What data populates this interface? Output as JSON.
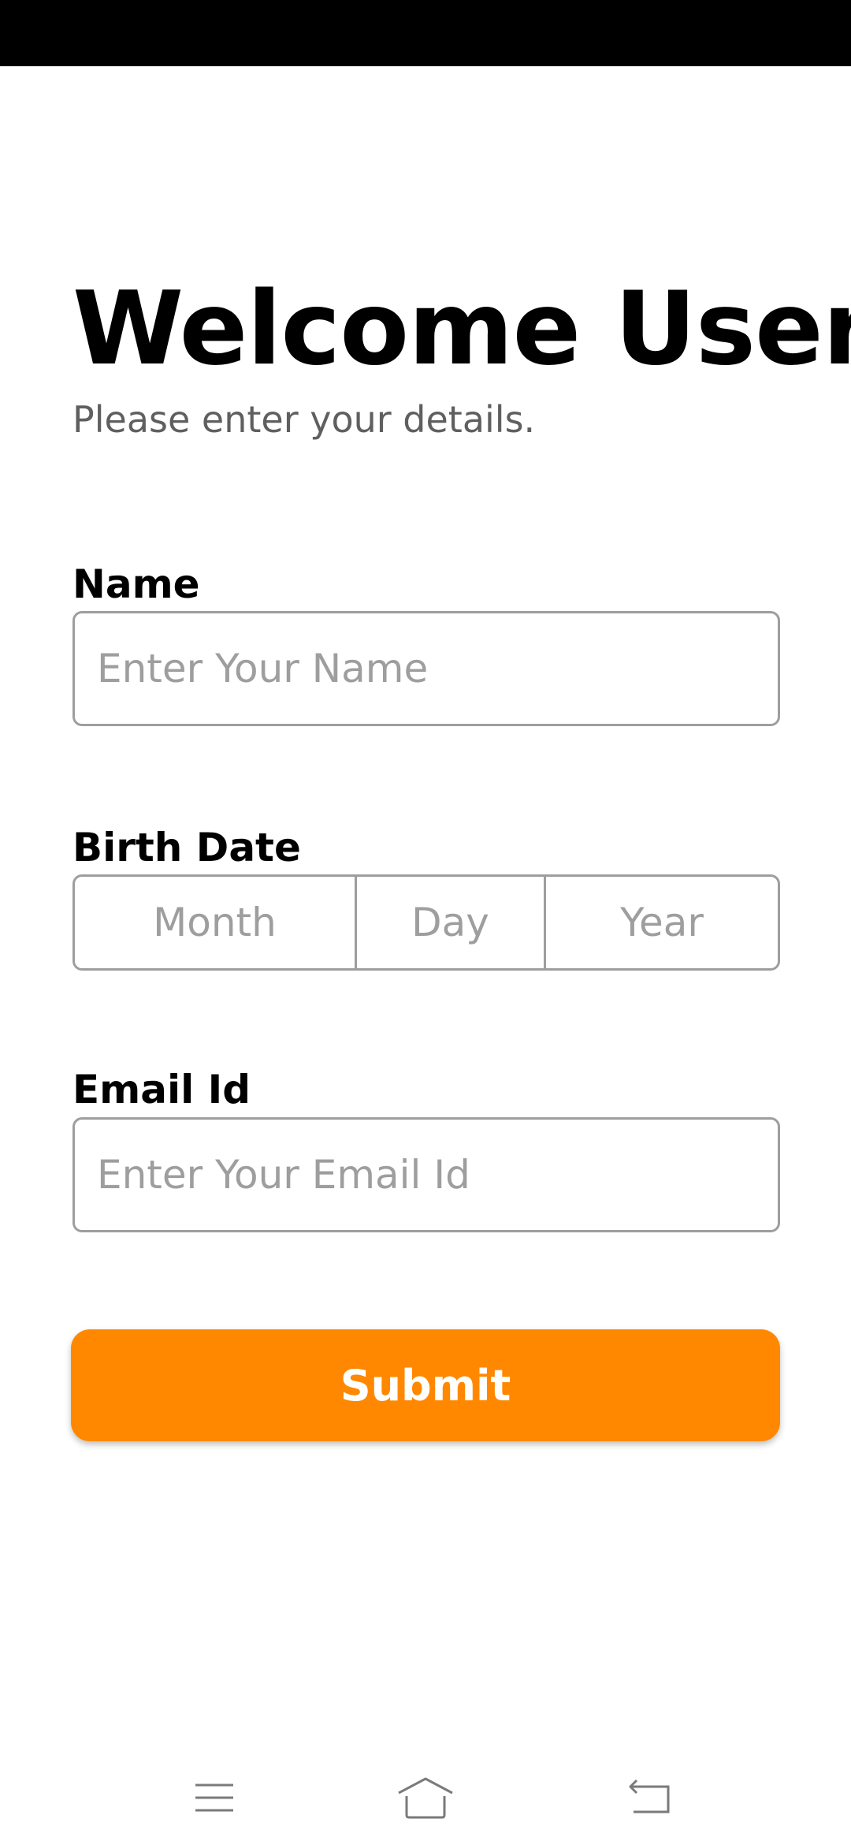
{
  "colors": {
    "accent": "#ff8800",
    "status_bar": "#000000",
    "border": "#9e9e9e",
    "placeholder": "#9e9e9e",
    "subtitle": "#5f5f5f"
  },
  "header": {
    "title": "Welcome User",
    "subtitle": "Please enter your details."
  },
  "form": {
    "name": {
      "label": "Name",
      "value": "",
      "placeholder": "Enter Your Name"
    },
    "birth_date": {
      "label": "Birth Date",
      "month_placeholder": "Month",
      "day_placeholder": "Day",
      "year_placeholder": "Year"
    },
    "email": {
      "label": "Email Id",
      "value": "",
      "placeholder": "Enter Your Email Id"
    },
    "submit_label": "Submit"
  },
  "nav_bar": {
    "icons": [
      "menu-icon",
      "home-icon",
      "back-icon"
    ]
  }
}
